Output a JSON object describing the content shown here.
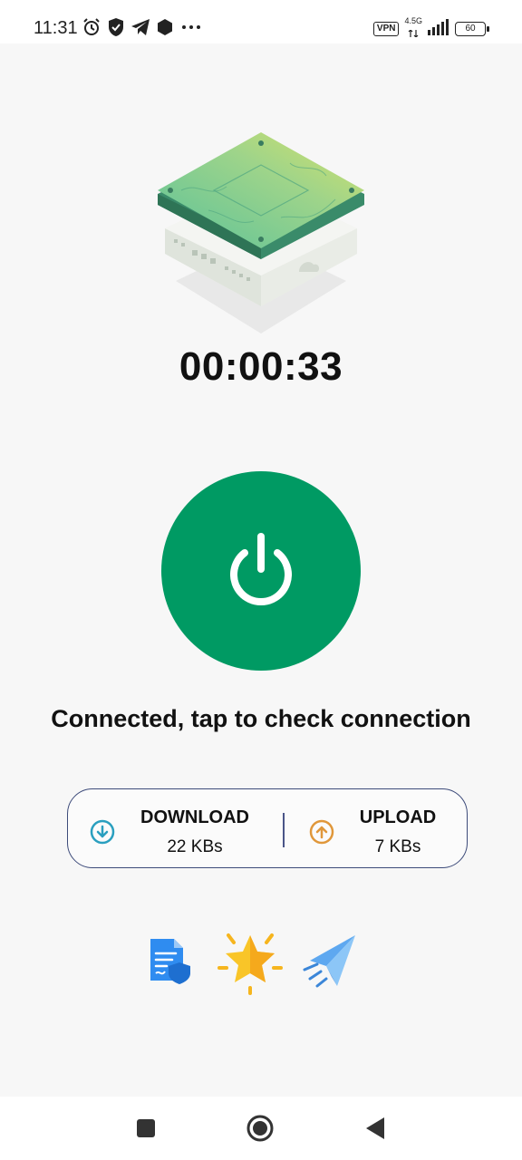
{
  "status_bar": {
    "time": "11:31",
    "left_icons": [
      "alarm-icon",
      "shield-check-icon",
      "telegram-icon",
      "hexagon-icon",
      "more-dots-icon"
    ],
    "vpn_label": "VPN",
    "network_label": "4.5G",
    "battery": "60"
  },
  "connection": {
    "timer": "00:00:33",
    "status_message": "Connected, tap to check connection",
    "accent_color": "#009a63"
  },
  "stats": {
    "download_title": "DOWNLOAD",
    "download_value": "22 KBs",
    "upload_title": "UPLOAD",
    "upload_value": "7 KBs",
    "download_color": "#2a9fbf",
    "upload_color": "#e0973a"
  },
  "shortcuts": [
    "privacy-policy-icon",
    "rate-star-icon",
    "share-plane-icon"
  ],
  "nav": [
    "recent-apps",
    "home",
    "back"
  ]
}
